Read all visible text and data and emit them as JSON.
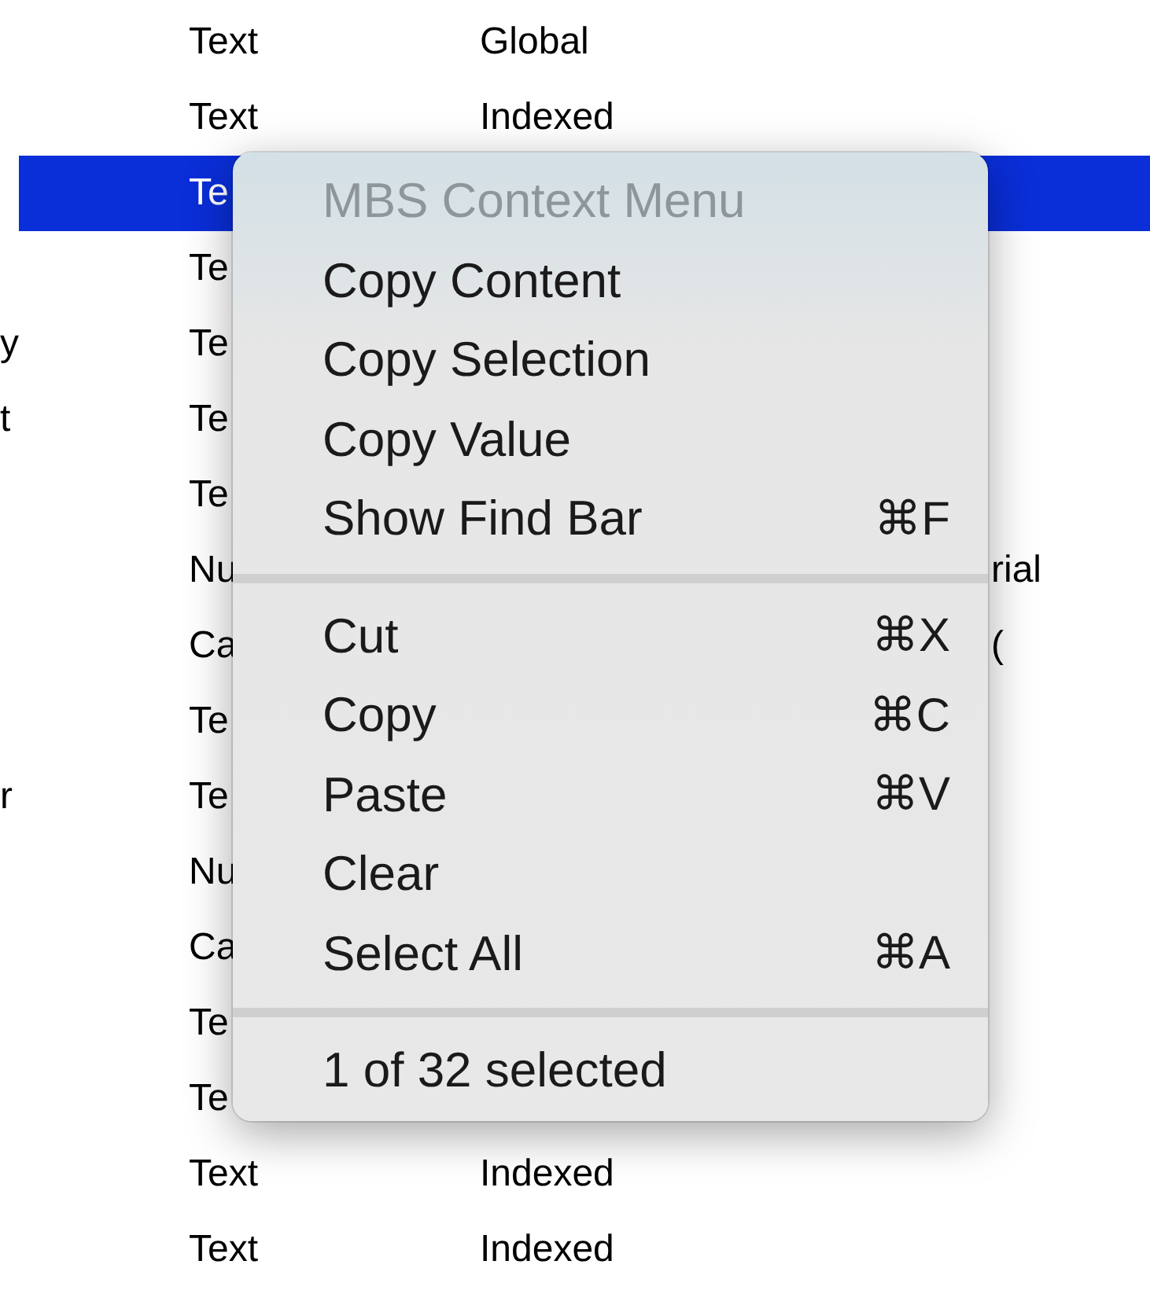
{
  "table": {
    "rows": [
      {
        "selected": false,
        "column_1": "",
        "column_2": "Text",
        "column_3": "Global",
        "column_4": ""
      },
      {
        "selected": false,
        "column_1": "",
        "column_2": "Text",
        "column_3": "Indexed",
        "column_4": ""
      },
      {
        "selected": true,
        "column_1": "",
        "column_2": "Te",
        "column_3": "",
        "column_4": ""
      },
      {
        "selected": false,
        "column_1": "",
        "column_2": "Te",
        "column_3": "",
        "column_4": ""
      },
      {
        "selected": false,
        "column_1": "y",
        "column_2": "Te",
        "column_3": "",
        "column_4": ""
      },
      {
        "selected": false,
        "column_1": "t",
        "column_2": "Te",
        "column_3": "",
        "column_4": ""
      },
      {
        "selected": false,
        "column_1": "",
        "column_2": "Te",
        "column_3": "",
        "column_4": ""
      },
      {
        "selected": false,
        "column_1": "",
        "column_2": "Nu",
        "column_3": "",
        "column_4": "rial"
      },
      {
        "selected": false,
        "column_1": "",
        "column_2": "Ca",
        "column_3": "",
        "column_4": "("
      },
      {
        "selected": false,
        "column_1": "",
        "column_2": "Te",
        "column_3": "",
        "column_4": ""
      },
      {
        "selected": false,
        "column_1": "r",
        "column_2": "Te",
        "column_3": "",
        "column_4": ""
      },
      {
        "selected": false,
        "column_1": "",
        "column_2": "Nu",
        "column_3": "",
        "column_4": ""
      },
      {
        "selected": false,
        "column_1": "",
        "column_2": "Ca",
        "column_3": "",
        "column_4": ""
      },
      {
        "selected": false,
        "column_1": "",
        "column_2": "Te",
        "column_3": "",
        "column_4": ""
      },
      {
        "selected": false,
        "column_1": "",
        "column_2": "Te",
        "column_3": "",
        "column_4": ""
      },
      {
        "selected": false,
        "column_1": "",
        "column_2": "Text",
        "column_3": "Indexed",
        "column_4": ""
      },
      {
        "selected": false,
        "column_1": "",
        "column_2": "Text",
        "column_3": "Indexed",
        "column_4": ""
      }
    ]
  },
  "context_menu": {
    "items": [
      {
        "kind": "header",
        "label": "MBS Context Menu",
        "disabled": true
      },
      {
        "kind": "item",
        "label": "Copy Content",
        "disabled": false
      },
      {
        "kind": "item",
        "label": "Copy Selection",
        "disabled": false
      },
      {
        "kind": "item",
        "label": "Copy Value",
        "disabled": false
      },
      {
        "kind": "item",
        "label": "Show Find Bar",
        "shortcut": "⌘F",
        "disabled": false
      },
      {
        "kind": "separator"
      },
      {
        "kind": "item",
        "label": "Cut",
        "shortcut": "⌘X",
        "disabled": false
      },
      {
        "kind": "item",
        "label": "Copy",
        "shortcut": "⌘C",
        "disabled": false
      },
      {
        "kind": "item",
        "label": "Paste",
        "shortcut": "⌘V",
        "disabled": false
      },
      {
        "kind": "item",
        "label": "Clear",
        "disabled": false
      },
      {
        "kind": "item",
        "label": "Select All",
        "shortcut": "⌘A",
        "disabled": false
      },
      {
        "kind": "separator"
      },
      {
        "kind": "status",
        "label": "1 of 32 selected",
        "disabled": false
      }
    ]
  }
}
